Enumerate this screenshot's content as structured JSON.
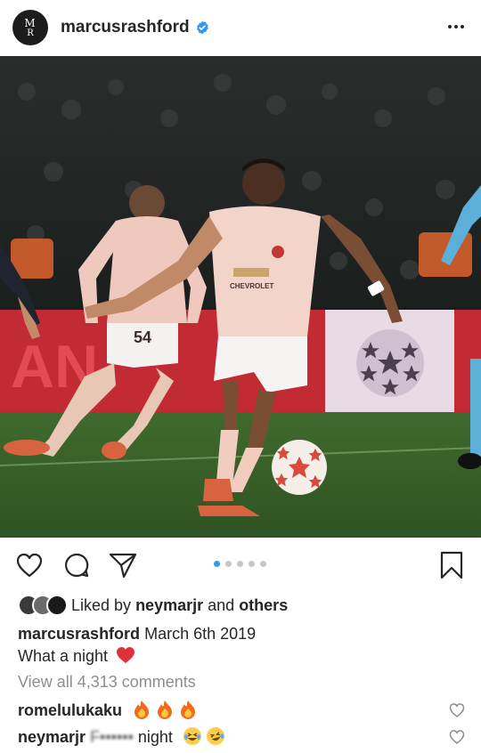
{
  "header": {
    "avatar_monogram_top": "M",
    "avatar_monogram_bottom": "R",
    "username": "marcusrashford",
    "verified_icon": "verified-badge-icon",
    "more_icon": "more-options-icon"
  },
  "photo": {
    "description_icon": "post-photo",
    "shirt_sponsor": "CHEVROLET",
    "shirt_number": "54"
  },
  "actions": {
    "like_icon": "heart-icon",
    "comment_icon": "comment-icon",
    "share_icon": "share-icon",
    "save_icon": "bookmark-icon",
    "carousel_count": 5,
    "carousel_active": 0
  },
  "likes": {
    "prefix": "Liked by",
    "user": "neymarjr",
    "joiner": "and",
    "others": "others"
  },
  "caption": {
    "username": "marcusrashford",
    "date": "March 6th 2019",
    "text": "What a night"
  },
  "comments": {
    "view_all": "View all 4,313 comments",
    "items": [
      {
        "username": "romelulukaku",
        "text": "",
        "emoji": "fire-emoji x3"
      },
      {
        "username": "neymarjr",
        "text_censored": "F••••••",
        "text_after": "night",
        "emoji": "laughing-emoji"
      }
    ]
  },
  "colors": {
    "accent": "#3897f0",
    "text": "#262626",
    "muted": "#8e8e8e",
    "heart": "#ed4956"
  }
}
